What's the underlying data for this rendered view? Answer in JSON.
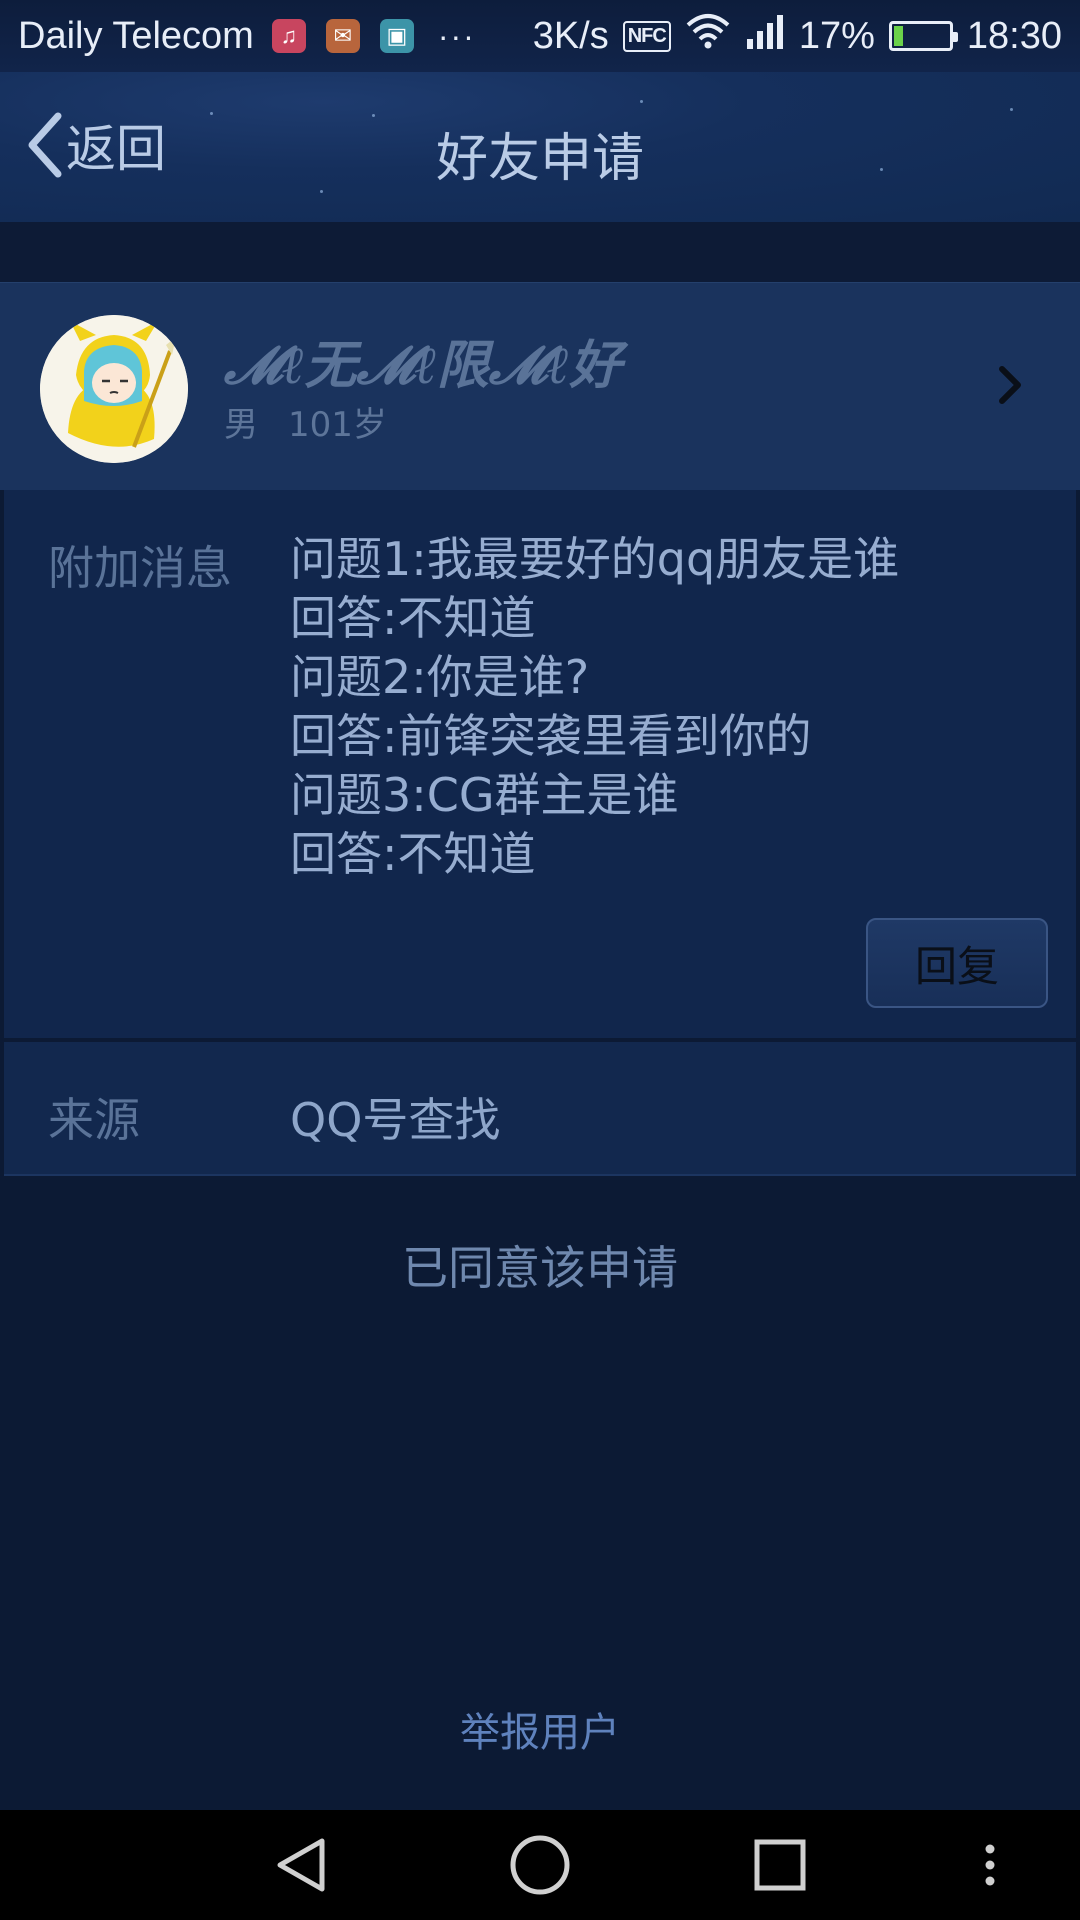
{
  "status_bar": {
    "carrier": "Daily Telecom",
    "notification_icons": [
      "music-icon",
      "mail-icon",
      "gallery-icon"
    ],
    "more": "···",
    "speed": "3K/s",
    "nfc": "NFC",
    "battery_percent": "17%",
    "battery_level": 0.17,
    "time": "18:30"
  },
  "header": {
    "back_label": "返回",
    "title": "好友申请"
  },
  "profile": {
    "nickname": "𝓜ℓ无𝓜ℓ限𝓜ℓ好",
    "gender": "男",
    "age": "101岁"
  },
  "message": {
    "label": "附加消息",
    "lines": [
      "问题1:我最要好的qq朋友是谁",
      "回答:不知道",
      "问题2:你是谁?",
      "回答:前锋突袭里看到你的",
      "问题3:CG群主是谁",
      "回答:不知道"
    ],
    "reply_button": "回复"
  },
  "source": {
    "label": "来源",
    "value": "QQ号查找"
  },
  "status_text": "已同意该申请",
  "report_link": "举报用户",
  "colors": {
    "background": "#0c1a34",
    "header": "#152f5c",
    "profile_row": "#1a335d",
    "card": "#11264c",
    "link": "#5f82bd"
  }
}
